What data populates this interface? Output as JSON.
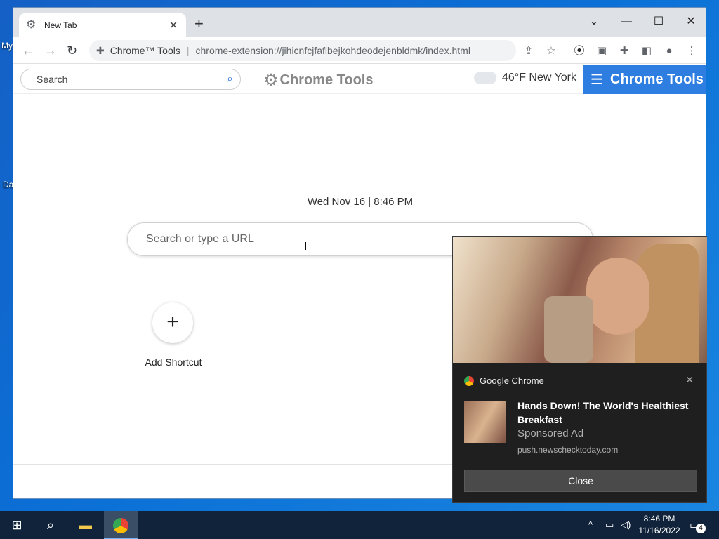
{
  "desktop": {
    "icon_labels": [
      "My",
      "Da"
    ]
  },
  "browser": {
    "tab": {
      "title": "New Tab"
    },
    "window_controls": {
      "dropdown": "⌄",
      "minimize": "—",
      "maximize": "☐",
      "close": "✕"
    },
    "omnibox": {
      "extension_name": "Chrome™ Tools",
      "url": "chrome-extension://jihicnfcjfaflbejkohdeodejenbldmk/index.html"
    }
  },
  "page": {
    "header": {
      "search_placeholder": "Search",
      "brand": "Chrome Tools",
      "weather": "46°F New York",
      "menu_button": "Chrome Tools"
    },
    "datetime": "Wed Nov 16 | 8:46 PM",
    "main_search_placeholder": "Search or type a URL",
    "shortcut": {
      "label": "Add Shortcut"
    }
  },
  "notification": {
    "app_name": "Google Chrome",
    "headline": "Hands Down! The World's Healthiest Breakfast",
    "sponsored": "Sponsored Ad",
    "domain": "push.newschecktoday.com",
    "close_label": "Close"
  },
  "taskbar": {
    "time": "8:46 PM",
    "date": "11/16/2022",
    "notification_count": "4"
  },
  "colors": {
    "accent_blue": "#2d7ee0",
    "notification_bg": "#1f1f1f",
    "taskbar_bg": "#10233a"
  }
}
